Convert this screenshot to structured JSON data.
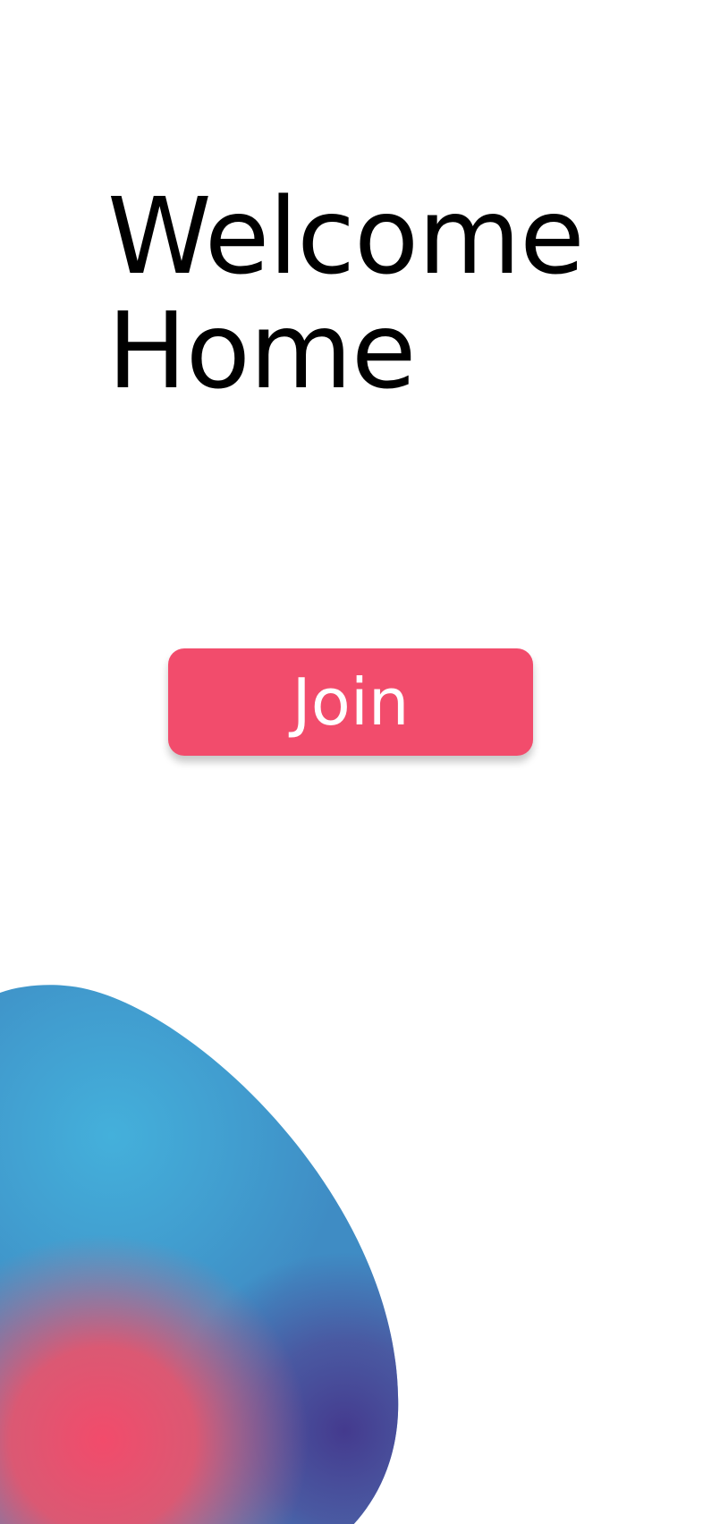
{
  "header": {
    "title_line1": "Welcome",
    "title_line2": "Home"
  },
  "actions": {
    "join_label": "Join"
  },
  "colors": {
    "background": "#ffffff",
    "title_text": "#000000",
    "join_button": "#f24c6c",
    "join_text": "#ffffff",
    "blob_blue": "#43aedb",
    "blob_pink": "#f24c6c",
    "blob_purple": "#423c90"
  }
}
